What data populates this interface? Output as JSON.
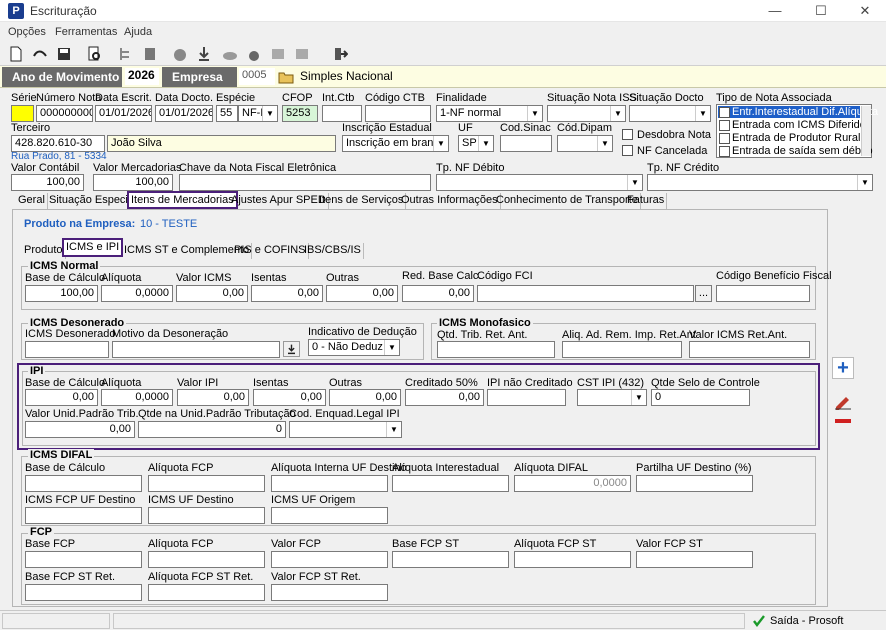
{
  "window": {
    "title": "Escrituração",
    "min": "—",
    "max": "☐",
    "close": "✕"
  },
  "menu": [
    "Opções",
    "Ferramentas",
    "Ajuda"
  ],
  "header": {
    "ano_label": "Ano de Movimento",
    "ano_value": "2026",
    "empresa_label": "Empresa",
    "empresa_code": "0005",
    "empresa_name": "Simples Nacional"
  },
  "doc": {
    "serie_label": "Série",
    "numero_label": "Número Nota",
    "numero": "0000000001",
    "escrit_label": "Data Escrit.",
    "escrit": "01/01/2026",
    "docto_label": "Data Docto.",
    "docto": "01/01/2026",
    "especie_label": "Espécie",
    "especie_code": "55",
    "especie": "NF-E",
    "cfop_label": "CFOP",
    "cfop": "5253",
    "intctb_label": "Int.Ctb",
    "codctb_label": "Código CTB",
    "finalidade_label": "Finalidade",
    "finalidade": "1-NF normal",
    "sitiss_label": "Situação Nota ISS",
    "sitdocto_label": "Situação Docto",
    "tiponota_label": "Tipo de Nota Associada",
    "tiponota_items": [
      "Entr.Interestadual Dif.Alíquota",
      "Entrada com ICMS Diferido",
      "Entrada de Produtor Rural",
      "Entrada de saída sem débito"
    ],
    "terceiro_label": "Terceiro",
    "terceiro_cnpj": "428.820.610-30",
    "terceiro_nome": "João Silva",
    "endereco": "Rua Prado, 81 - 5334",
    "ie_label": "Inscrição Estadual",
    "ie": "Inscrição em branco",
    "uf_label": "UF",
    "uf": "SP",
    "codsinac_label": "Cod.Sinac",
    "coddipam_label": "Cód.Dipam",
    "desdobra_label": "Desdobra Nota",
    "nfcanc_label": "NF Cancelada",
    "vcontabil_label": "Valor Contábil",
    "vcontabil": "100,00",
    "vmerc_label": "Valor Mercadorias",
    "vmerc": "100,00",
    "chave_label": "Chave da Nota Fiscal Eletrônica",
    "tpdebito_label": "Tp. NF Débito",
    "tpcredito_label": "Tp. NF Crédito"
  },
  "tabs": [
    "Geral",
    "Situação Especial",
    "Itens de Mercadorias",
    "Ajustes Apur SPED",
    "Itens de Serviços",
    "Outras Informações",
    "Conhecimento de Transporte",
    "Faturas"
  ],
  "produto": {
    "label": "Produto na Empresa:",
    "value": "10 - TESTE"
  },
  "subtabs": [
    "Produto",
    "ICMS e IPI",
    "ICMS ST e Complemento",
    "PIS e COFINS",
    "IBS/CBS/IS"
  ],
  "icms_normal": {
    "title": "ICMS Normal",
    "base_label": "Base de Cálculo",
    "base": "100,00",
    "aliq_label": "Alíquota",
    "aliq": "0,0000",
    "valor_label": "Valor ICMS",
    "valor": "0,00",
    "isentas_label": "Isentas",
    "isentas": "0,00",
    "outras_label": "Outras",
    "outras": "0,00",
    "red_label": "Red. Base Calc.",
    "red": "0,00",
    "fci_label": "Código FCI",
    "fci_btn": "...",
    "benef_label": "Código Benefício Fiscal"
  },
  "icms_deson": {
    "title": "ICMS Desonerado",
    "valor_label": "ICMS Desonerado",
    "motivo_label": "Motivo da Desoneração",
    "ind_label": "Indicativo de Dedução",
    "ind": "0 - Não Deduz"
  },
  "icms_mono": {
    "title": "ICMS Monofasico",
    "qtd_label": "Qtd. Trib. Ret. Ant.",
    "aliq_label": "Aliq. Ad. Rem. Imp. Ret.Ant",
    "valor_label": "Valor ICMS Ret.Ant."
  },
  "ipi": {
    "title": "IPI",
    "base_label": "Base de Cálculo",
    "base": "0,00",
    "aliq_label": "Alíquota",
    "aliq": "0,0000",
    "valor_label": "Valor IPI",
    "valor": "0,00",
    "isentas_label": "Isentas",
    "isentas": "0,00",
    "outras_label": "Outras",
    "outras": "0,00",
    "cred50_label": "Creditado 50%",
    "cred50": "0,00",
    "naocred_label": "IPI não Creditado",
    "cst_label": "CST IPI (432)",
    "selo_label": "Qtde Selo de Controle",
    "selo": "0",
    "vunid_label": "Valor Unid.Padrão Trib.",
    "vunid": "0,00",
    "qtde_label": "Qtde na Unid.Padrão Tributação",
    "qtde": "0",
    "enq_label": "Cod. Enquad.Legal IPI"
  },
  "difal": {
    "title": "ICMS DIFAL",
    "base_label": "Base de Cálculo",
    "aliqfcp_label": "Alíquota FCP",
    "aliqint_label": "Alíquota Interna UF Destino",
    "aliqinter_label": "Alíquota Interestadual",
    "aliqdifal_label": "Alíquota DIFAL",
    "aliqdifal": "0,0000",
    "partilha_label": "Partilha UF Destino (%)",
    "fcpdest_label": "ICMS FCP UF Destino",
    "ufdest_label": "ICMS UF Destino",
    "uforig_label": "ICMS UF Origem"
  },
  "fcp": {
    "title": "FCP",
    "base_label": "Base FCP",
    "aliq_label": "Alíquota FCP",
    "valor_label": "Valor FCP",
    "basest_label": "Base FCP ST",
    "aliqst_label": "Alíquota FCP ST",
    "valorst_label": "Valor FCP ST",
    "baseret_label": "Base FCP ST Ret.",
    "aliqret_label": "Alíquota FCP ST Ret.",
    "valorret_label": "Valor FCP ST Ret."
  },
  "status": {
    "text": "Saída - Prosoft"
  },
  "colors": {
    "highlight": "#4b1f7a",
    "header_bg": "#fdfde2",
    "link": "#1f5fbf"
  }
}
